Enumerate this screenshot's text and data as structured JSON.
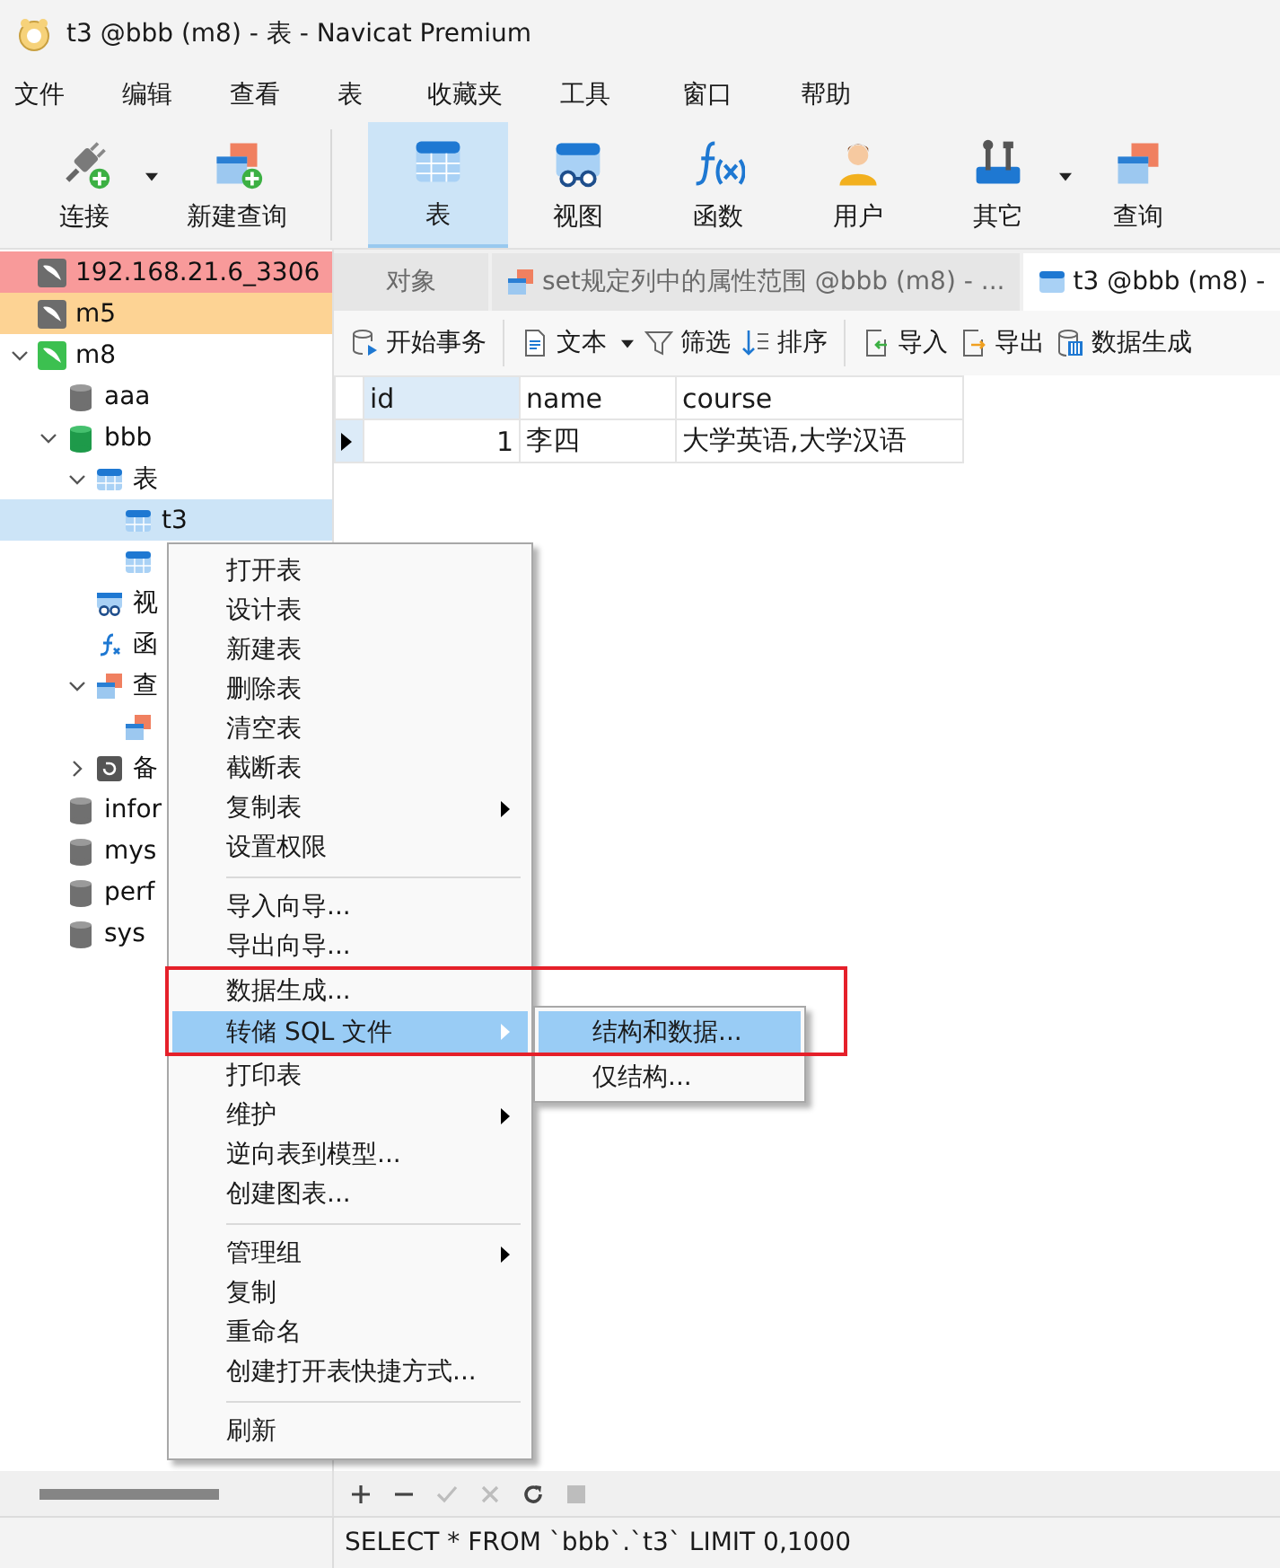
{
  "window": {
    "title": "t3 @bbb (m8) - 表 - Navicat Premium"
  },
  "menu_bar": [
    "文件",
    "编辑",
    "查看",
    "表",
    "收藏夹",
    "工具",
    "窗口",
    "帮助"
  ],
  "toolbar": [
    {
      "kind": "connect",
      "label": "连接",
      "selected": false,
      "dropdown": true
    },
    {
      "kind": "new-query",
      "label": "新建查询",
      "selected": false,
      "dropdown": false
    },
    {
      "kind": "table",
      "label": "表",
      "selected": true,
      "dropdown": false
    },
    {
      "kind": "view",
      "label": "视图",
      "selected": false,
      "dropdown": false
    },
    {
      "kind": "function",
      "label": "函数",
      "selected": false,
      "dropdown": false
    },
    {
      "kind": "user",
      "label": "用户",
      "selected": false,
      "dropdown": false
    },
    {
      "kind": "other",
      "label": "其它",
      "selected": false,
      "dropdown": true
    },
    {
      "kind": "query",
      "label": "查询",
      "selected": false,
      "dropdown": false
    }
  ],
  "sidebar": {
    "tree": [
      {
        "kind": "connection",
        "label": "192.168.21.6_3306",
        "connected": false,
        "color": "#f89a9a",
        "selected": false
      },
      {
        "kind": "connection",
        "label": "m5",
        "connected": false,
        "color": "#fdd394",
        "selected": false
      },
      {
        "kind": "connection",
        "label": "m8",
        "connected": true,
        "selected": false,
        "expanded": true,
        "children": [
          {
            "kind": "database",
            "label": "aaa",
            "connected": false,
            "selected": false
          },
          {
            "kind": "database",
            "label": "bbb",
            "connected": true,
            "selected": false,
            "expanded": true,
            "children": [
              {
                "kind": "tables",
                "label": "表",
                "selected": false,
                "expanded": true,
                "children": [
                  {
                    "kind": "table",
                    "label": "t3",
                    "selected": true
                  },
                  {
                    "kind": "table",
                    "selected": false
                  }
                ]
              },
              {
                "kind": "views",
                "label": "视",
                "selected": false
              },
              {
                "kind": "functions",
                "label": "函",
                "selected": false
              },
              {
                "kind": "queries",
                "label": "查",
                "selected": false,
                "expanded": true,
                "children": [
                  {
                    "kind": "query",
                    "selected": false
                  }
                ]
              },
              {
                "kind": "backups",
                "label": "备",
                "selected": false,
                "expanded": false
              }
            ]
          },
          {
            "kind": "database",
            "label": "infor",
            "connected": false,
            "selected": false
          },
          {
            "kind": "database",
            "label": "mys",
            "connected": false,
            "selected": false
          },
          {
            "kind": "database",
            "label": "perf",
            "connected": false,
            "selected": false
          },
          {
            "kind": "database",
            "label": "sys",
            "connected": false,
            "selected": false
          }
        ]
      }
    ]
  },
  "tabs": [
    {
      "kind": "objects",
      "label": "对象",
      "selected": false
    },
    {
      "kind": "query",
      "label": "set规定列中的属性范围 @bbb (m8) - ...",
      "selected": false
    },
    {
      "kind": "table",
      "label": "t3 @bbb (m8) -",
      "selected": true
    }
  ],
  "data_toolbar": [
    {
      "kind": "transaction",
      "label": "开始事务",
      "dropdown": false
    },
    {
      "kind": "text",
      "label": "文本",
      "dropdown": true
    },
    {
      "kind": "filter",
      "label": "筛选",
      "dropdown": false
    },
    {
      "kind": "sort",
      "label": "排序",
      "dropdown": false
    },
    {
      "kind": "import",
      "label": "导入",
      "dropdown": false
    },
    {
      "kind": "export",
      "label": "导出",
      "dropdown": false
    },
    {
      "kind": "generate",
      "label": "数据生成",
      "dropdown": false
    }
  ],
  "table": {
    "columns": [
      {
        "label": "id",
        "selected": true
      },
      {
        "label": "name",
        "selected": false
      },
      {
        "label": "course",
        "selected": false
      }
    ],
    "rows": [
      {
        "selected": true,
        "cells": [
          "1",
          "李四",
          "大学英语,大学汉语"
        ]
      }
    ]
  },
  "context_menu": {
    "items": [
      {
        "kind": "item",
        "label": "打开表",
        "submenu": false,
        "selected": false
      },
      {
        "kind": "item",
        "label": "设计表",
        "submenu": false,
        "selected": false
      },
      {
        "kind": "item",
        "label": "新建表",
        "submenu": false,
        "selected": false
      },
      {
        "kind": "item",
        "label": "删除表",
        "submenu": false,
        "selected": false
      },
      {
        "kind": "item",
        "label": "清空表",
        "submenu": false,
        "selected": false
      },
      {
        "kind": "item",
        "label": "截断表",
        "submenu": false,
        "selected": false
      },
      {
        "kind": "item",
        "label": "复制表",
        "submenu": true,
        "selected": false
      },
      {
        "kind": "item",
        "label": "设置权限",
        "submenu": false,
        "selected": false
      },
      {
        "kind": "separator"
      },
      {
        "kind": "item",
        "label": "导入向导...",
        "submenu": false,
        "selected": false
      },
      {
        "kind": "item",
        "label": "导出向导...",
        "submenu": false,
        "selected": false
      },
      {
        "kind": "item",
        "label": "数据生成...",
        "submenu": false,
        "selected": false
      },
      {
        "kind": "item",
        "label": "转储 SQL 文件",
        "submenu": true,
        "selected": true
      },
      {
        "kind": "item",
        "label": "打印表",
        "submenu": false,
        "selected": false
      },
      {
        "kind": "item",
        "label": "维护",
        "submenu": true,
        "selected": false
      },
      {
        "kind": "item",
        "label": "逆向表到模型...",
        "submenu": false,
        "selected": false
      },
      {
        "kind": "item",
        "label": "创建图表...",
        "submenu": false,
        "selected": false
      },
      {
        "kind": "separator"
      },
      {
        "kind": "item",
        "label": "管理组",
        "submenu": true,
        "selected": false
      },
      {
        "kind": "item",
        "label": "复制",
        "submenu": false,
        "selected": false
      },
      {
        "kind": "item",
        "label": "重命名",
        "submenu": false,
        "selected": false
      },
      {
        "kind": "item",
        "label": "创建打开表快捷方式...",
        "submenu": false,
        "selected": false
      },
      {
        "kind": "separator"
      },
      {
        "kind": "item",
        "label": "刷新",
        "submenu": false,
        "selected": false
      }
    ],
    "submenu": [
      {
        "label": "结构和数据...",
        "selected": true
      },
      {
        "label": "仅结构...",
        "selected": false
      }
    ]
  },
  "bottom_toolbar": [
    {
      "kind": "add",
      "disabled": false
    },
    {
      "kind": "remove",
      "disabled": false
    },
    {
      "kind": "apply",
      "disabled": true
    },
    {
      "kind": "discard",
      "disabled": true
    },
    {
      "kind": "refresh",
      "disabled": false
    },
    {
      "kind": "stop",
      "disabled": true
    }
  ],
  "status_bar": {
    "text": "SELECT * FROM `bbb`.`t3` LIMIT 0,1000"
  }
}
